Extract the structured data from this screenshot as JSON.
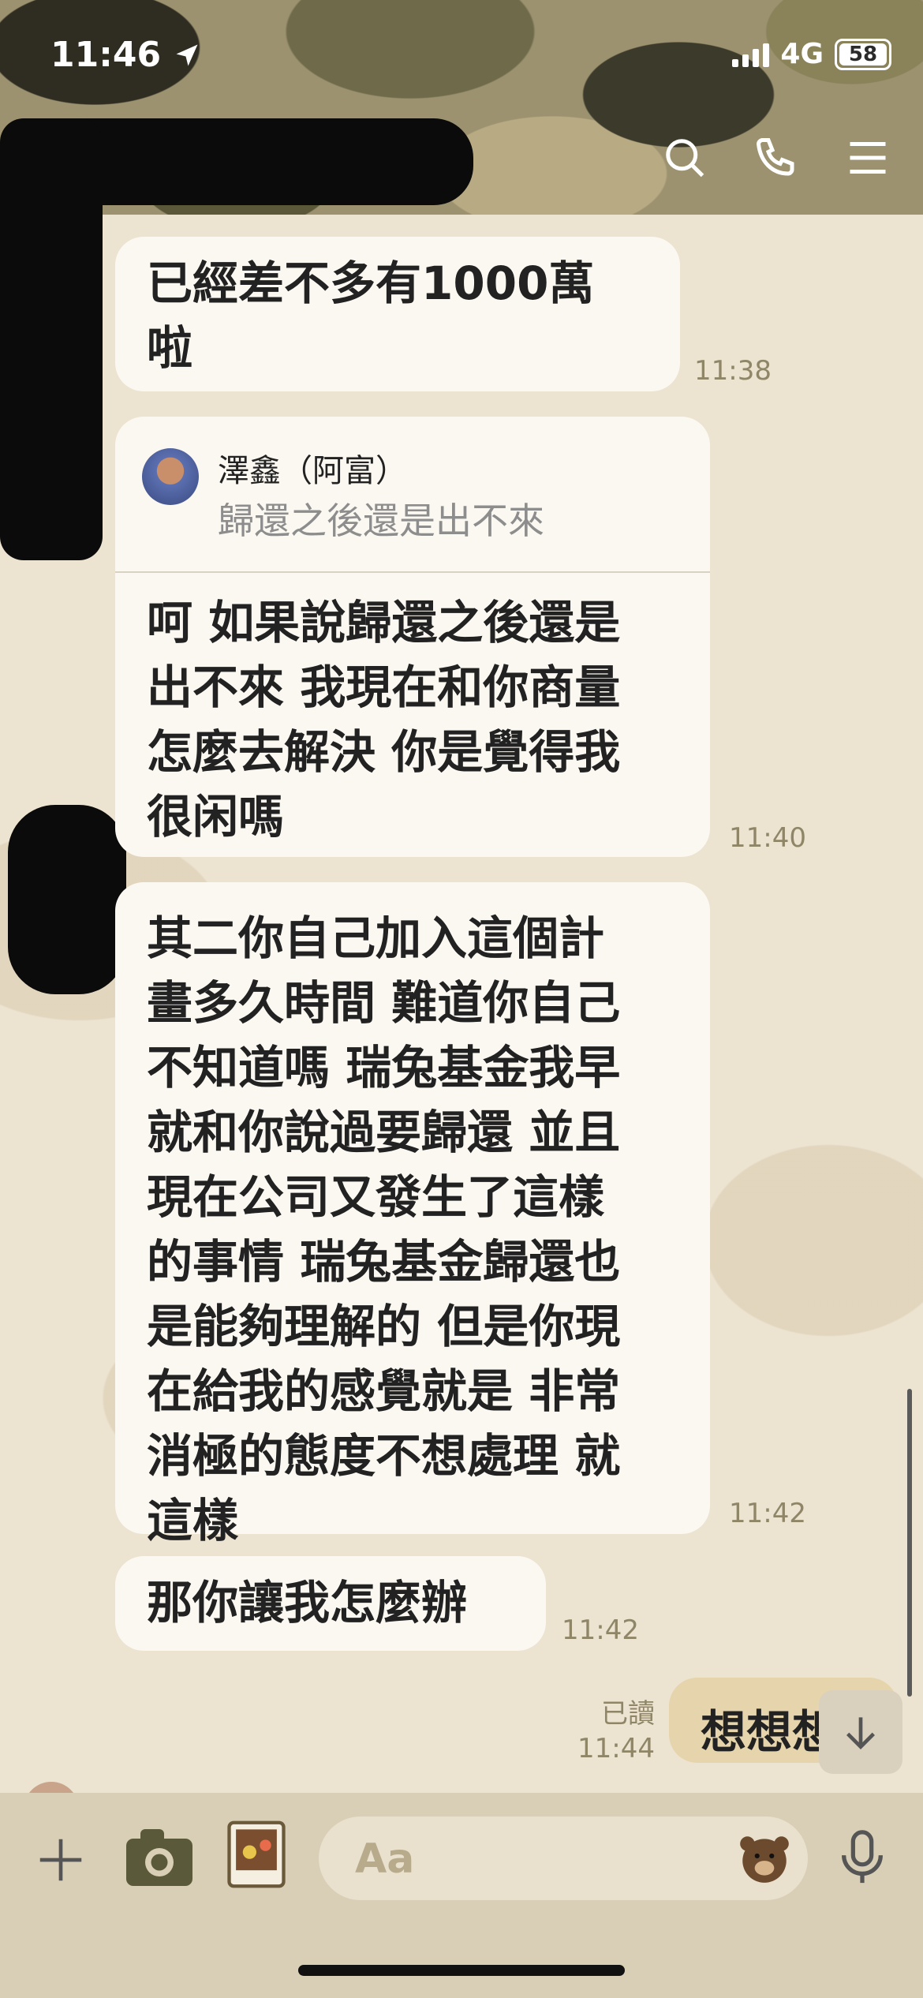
{
  "status_bar": {
    "time": "11:46",
    "network": "4G",
    "battery": "58"
  },
  "messages": [
    {
      "text_lines": [
        "已經差不多有1000萬",
        "啦"
      ],
      "time": "11:38"
    },
    {
      "reply": {
        "name": "澤鑫（阿富）",
        "quote": "歸還之後還是出不來"
      },
      "text_lines": [
        "呵 如果說歸還之後還是",
        "出不來 我現在和你商量",
        "怎麼去解決 你是覺得我",
        "很闲嗎"
      ],
      "time": "11:40"
    },
    {
      "text_lines": [
        "其二你自己加入這個計",
        "畫多久時間 難道你自己",
        "不知道嗎 瑞兔基金我早",
        "就和你說過要歸還 並且",
        "現在公司又發生了這樣",
        "的事情 瑞兔基金歸還也",
        "是能夠理解的 但是你現",
        "在給我的感覺就是 非常",
        "消極的態度不想處理 就",
        "這樣"
      ],
      "time": "11:42"
    },
    {
      "text_lines": [
        "那你讓我怎麼辦"
      ],
      "time": "11:42"
    }
  ],
  "sent_message": {
    "text": "想想想",
    "read_label": "已讀",
    "time": "11:44"
  },
  "input": {
    "placeholder": "Aa"
  },
  "icons": {
    "header": [
      "search-icon",
      "phone-icon",
      "menu-icon"
    ],
    "bottom": [
      "plus-icon",
      "camera-icon",
      "image-icon",
      "sticker-icon",
      "microphone-icon"
    ]
  }
}
